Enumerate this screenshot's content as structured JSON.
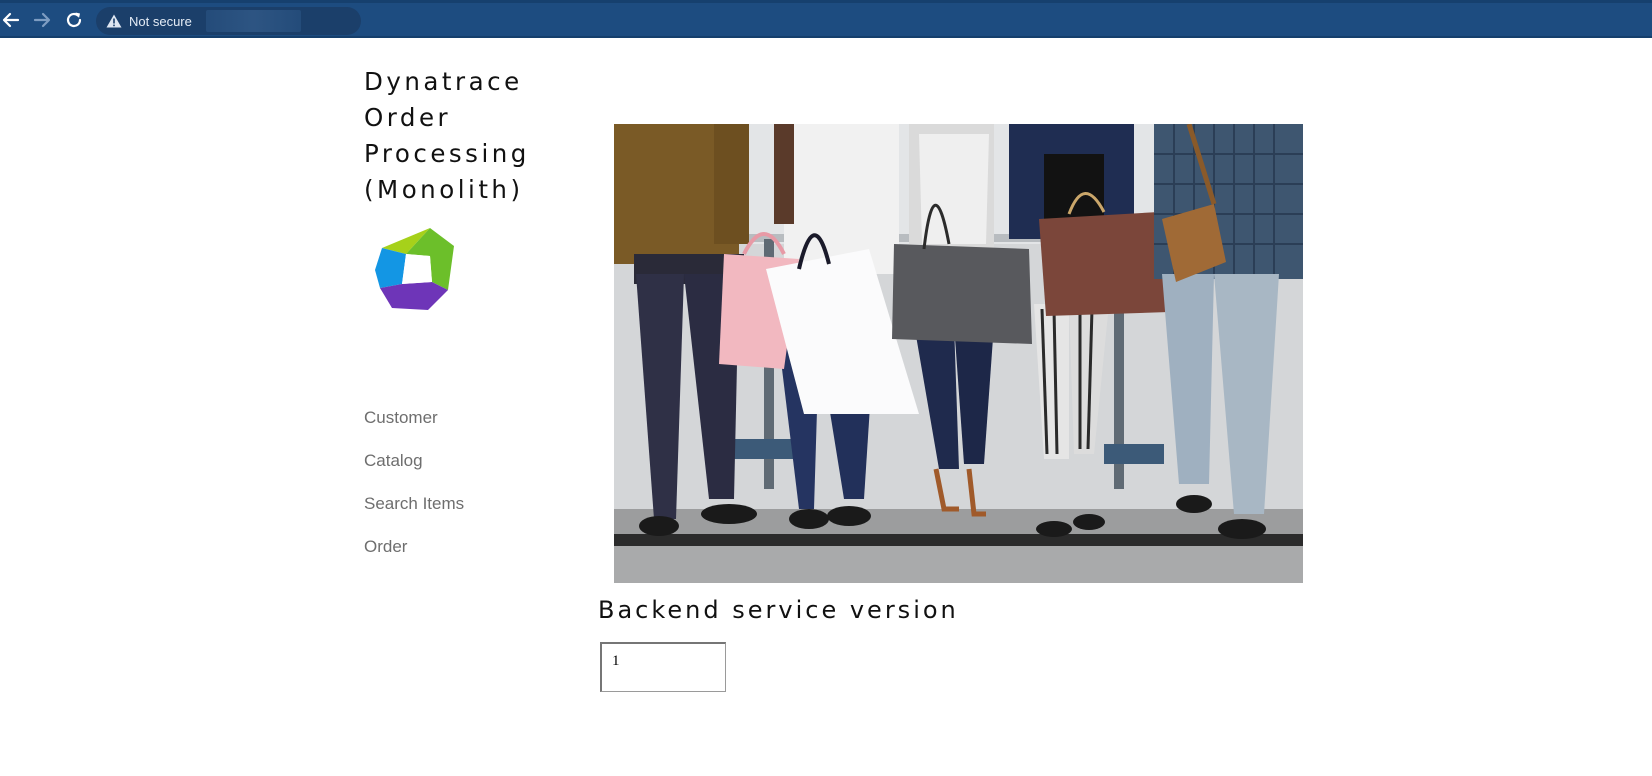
{
  "browser": {
    "security_label": "Not secure",
    "icons": {
      "back": "arrow-left-icon",
      "forward": "arrow-right-icon",
      "reload": "reload-icon",
      "warning": "warning-triangle-icon"
    },
    "colors": {
      "bar": "#1d4c80"
    }
  },
  "app": {
    "title_lines": [
      "Dynatrace",
      "Order",
      "Processing",
      "(Monolith)"
    ],
    "logo": "dynatrace-logo"
  },
  "nav": {
    "items": [
      {
        "label": "Customer"
      },
      {
        "label": "Catalog"
      },
      {
        "label": "Search Items"
      },
      {
        "label": "Order"
      }
    ]
  },
  "hero": {
    "image": "people-holding-shopping-bags"
  },
  "backend": {
    "heading": "Backend service version",
    "value": "1"
  }
}
